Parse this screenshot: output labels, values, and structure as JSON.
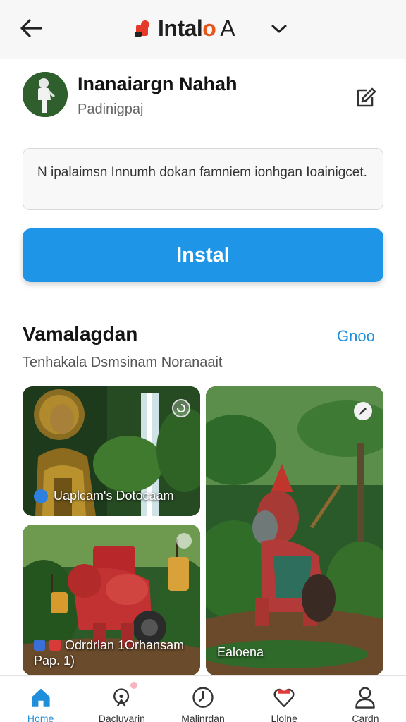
{
  "header": {
    "brand_main": "Intal",
    "brand_accent": "o",
    "brand_suffix": "A"
  },
  "profile": {
    "name": "Inanaiargn Nahah",
    "subtitle": "Padinigpaj"
  },
  "description": "N ipalaimsn Innumh dokan famniem ionhgan Ioainigcet.",
  "install_label": "Instal",
  "section": {
    "title": "Vamalagdan",
    "link": "Gnoo",
    "subtitle": "Tenhakala Dsmsinam Noranaait"
  },
  "cards": [
    {
      "caption": "Uaplcam's Dotocaam"
    },
    {
      "caption": "Ealoena"
    },
    {
      "caption_line1": "Odrdrlan 1Orhansam",
      "caption_line2": "Pap. 1)"
    }
  ],
  "bottom_nav": {
    "items": [
      {
        "label": "Home",
        "icon": "home-icon"
      },
      {
        "label": "Dacluvarin",
        "icon": "discover-icon"
      },
      {
        "label": "Malinrdan",
        "icon": "clock-icon"
      },
      {
        "label": "Llolne",
        "icon": "heart-icon"
      },
      {
        "label": "Cardn",
        "icon": "profile-icon"
      }
    ]
  },
  "colors": {
    "primary": "#1f95e8",
    "link": "#1f8fdc",
    "brand_accent": "#e8561a",
    "heart": "#e23b3b"
  }
}
